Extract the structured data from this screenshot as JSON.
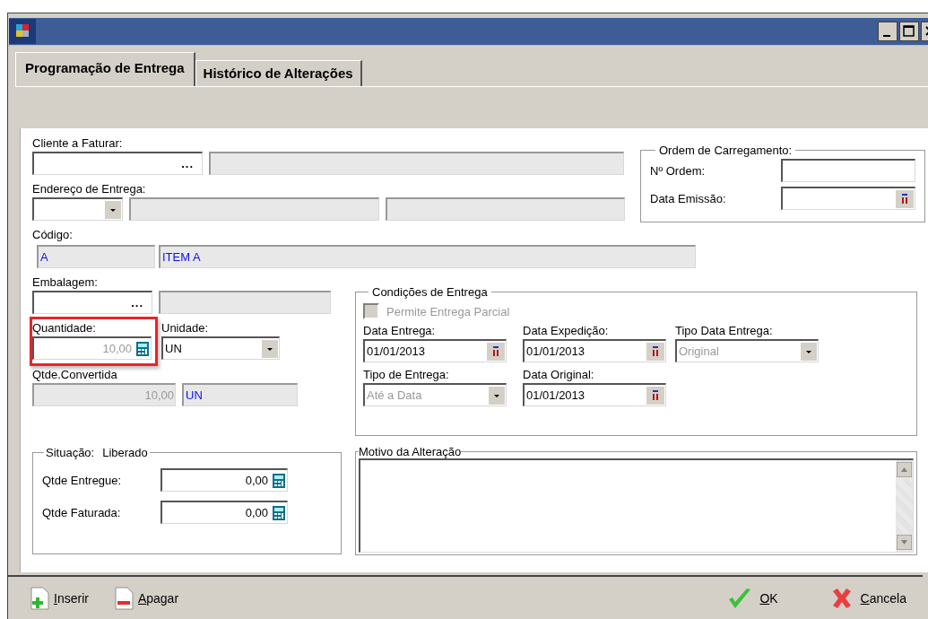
{
  "tabs": [
    {
      "label": "Programação de Entrega",
      "selected": true
    },
    {
      "label": "Histórico de Alterações",
      "selected": false
    }
  ],
  "cliente_a_faturar": {
    "label": "Cliente a Faturar:",
    "lookup": "..."
  },
  "endereco_de_entrega": {
    "label": "Endereço de Entrega:"
  },
  "codigo": {
    "label": "Código:",
    "code": "A",
    "description": "ITEM A"
  },
  "ordem_de_carregamento": {
    "title": "Ordem de Carregamento:",
    "fields": [
      {
        "label": "Nº Ordem:",
        "kind": "text"
      },
      {
        "label": "Data Emissão:",
        "kind": "date"
      }
    ]
  },
  "embalagem": {
    "label": "Embalagem:",
    "lookup": "..."
  },
  "quantidade": {
    "label": "Quantidade:",
    "value": "10,00",
    "disabled": true,
    "highlighted": true
  },
  "unidade": {
    "label": "Unidade:",
    "value": "UN"
  },
  "qtde_convertida": {
    "label": "Qtde.Convertida",
    "value": "10,00",
    "unit": "UN",
    "disabled": true
  },
  "situacao": {
    "label": "Situação:",
    "value": "Liberado",
    "rows": [
      {
        "label": "Qtde Entregue:",
        "value": "0,00"
      },
      {
        "label": "Qtde Faturada:",
        "value": "0,00"
      }
    ]
  },
  "condicoes_de_entrega": {
    "title": "Condições de Entrega",
    "permite_entrega_parcial": {
      "label": "Permite Entrega Parcial",
      "checked": false,
      "disabled": true
    },
    "fields": [
      {
        "label": "Data Entrega:",
        "value": "01/01/2013",
        "kind": "date",
        "disabled": false
      },
      {
        "label": "Data Expedição:",
        "value": "01/01/2013",
        "kind": "date",
        "disabled": false
      },
      {
        "label": "Tipo Data Entrega:",
        "value": "Original",
        "kind": "select",
        "disabled": true
      },
      {
        "label": "Tipo de Entrega:",
        "value": "Até a Data",
        "kind": "select",
        "disabled": true
      },
      {
        "label": "Data Original:",
        "value": "01/01/2013",
        "kind": "date",
        "disabled": false
      }
    ]
  },
  "motivo_da_alteracao": {
    "title": "Motivo da Alteração"
  },
  "actions": [
    {
      "label": "Inserir",
      "kind": "insert"
    },
    {
      "label": "Apagar",
      "kind": "delete"
    }
  ],
  "dialog_buttons": [
    {
      "label": "OK",
      "kind": "ok"
    },
    {
      "label": "Cancela",
      "kind": "cancel"
    }
  ]
}
